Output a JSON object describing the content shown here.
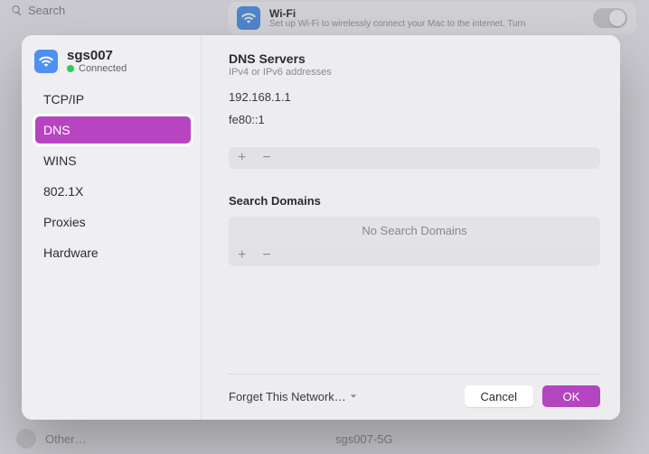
{
  "bg": {
    "search_placeholder": "Search",
    "wifi_title": "Wi-Fi",
    "wifi_sub": "Set up Wi-Fi to wirelessly connect your Mac to the internet. Turn",
    "bottom_left": "Other…",
    "bottom_center": "sgs007-5G"
  },
  "network": {
    "ssid": "sgs007",
    "status": "Connected"
  },
  "sidebar": {
    "items": [
      {
        "label": "TCP/IP"
      },
      {
        "label": "DNS"
      },
      {
        "label": "WINS"
      },
      {
        "label": "802.1X"
      },
      {
        "label": "Proxies"
      },
      {
        "label": "Hardware"
      }
    ],
    "selected_index": 1
  },
  "dns": {
    "title": "DNS Servers",
    "subtitle": "IPv4 or IPv6 addresses",
    "entries": [
      "192.168.1.1",
      "fe80::1"
    ],
    "add_glyph": "+",
    "remove_glyph": "−"
  },
  "search_domains": {
    "title": "Search Domains",
    "empty_text": "No Search Domains",
    "add_glyph": "+",
    "remove_glyph": "−"
  },
  "footer": {
    "forget_label": "Forget This Network…",
    "cancel_label": "Cancel",
    "ok_label": "OK"
  }
}
